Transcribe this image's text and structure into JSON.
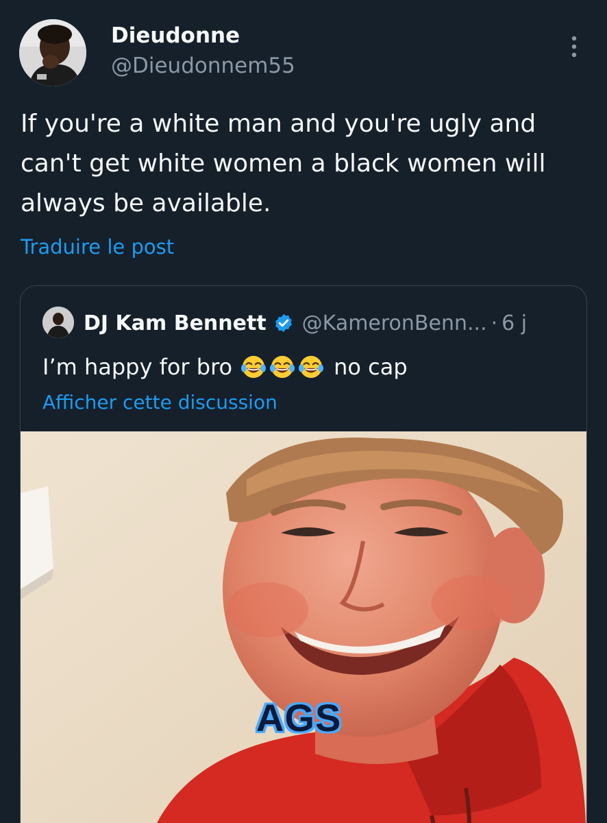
{
  "tweet": {
    "author_name": "Dieudonne",
    "author_handle": "@Dieudonnem55",
    "text": "If you're a white man and you're ugly and can't get white women a black women will always be available.",
    "translate_label": "Traduire le post"
  },
  "quote": {
    "author_name": "DJ Kam Bennett",
    "author_handle": "@KameronBenn...",
    "separator": "·",
    "time": "6 j",
    "text_before": "I’m happy for bro",
    "text_after": "no cap",
    "emoji": "face-with-tears-of-joy-icon",
    "show_thread_label": "Afficher cette discussion",
    "media_caption": "AGS"
  },
  "colors": {
    "background": "#15202b",
    "link": "#1d9bf0",
    "secondary_text": "#8b98a5",
    "border": "#38444d",
    "verified": "#1d9bf0"
  }
}
